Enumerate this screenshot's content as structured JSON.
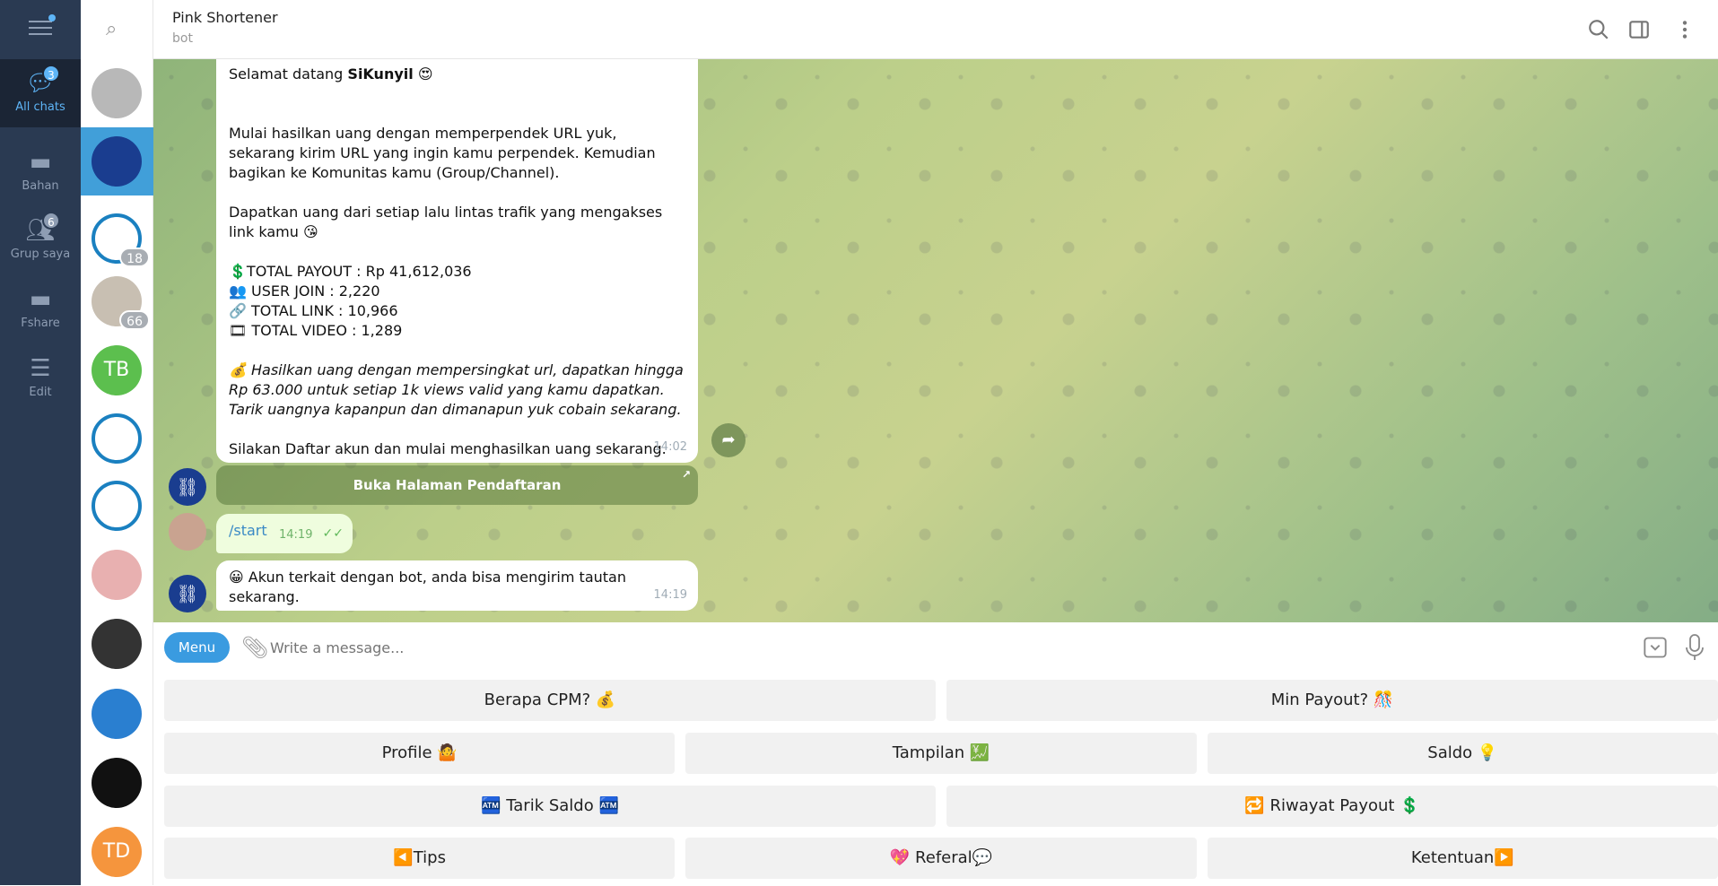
{
  "rail": {
    "items": [
      {
        "label": "All chats",
        "icon": "chat-bubbles-icon",
        "badge": "3",
        "active": true
      },
      {
        "label": "Bahan",
        "icon": "folder-icon"
      },
      {
        "label": "Grup saya",
        "icon": "users-icon",
        "badge": "6"
      },
      {
        "label": "Fshare",
        "icon": "folder-icon"
      },
      {
        "label": "Edit",
        "icon": "sliders-icon"
      }
    ]
  },
  "chat_list": [
    {
      "initials": "",
      "color": "#b8b8b8"
    },
    {
      "initials": "",
      "color": "#1a3d8f",
      "selected": true
    },
    {
      "initials": "",
      "color": "#ffffff",
      "count": "18"
    },
    {
      "initials": "",
      "color": "#c8bfb2",
      "count": "66"
    },
    {
      "initials": "TB",
      "color": "#5cbf4e"
    },
    {
      "initials": "",
      "color": "#ffffff"
    },
    {
      "initials": "",
      "color": "#ffffff"
    },
    {
      "initials": "",
      "color": "#e8b0b0"
    },
    {
      "initials": "",
      "color": "#333333"
    },
    {
      "initials": "",
      "color": "#2a7fd0"
    },
    {
      "initials": "",
      "color": "#111111"
    },
    {
      "initials": "TD",
      "color": "#f5953d"
    }
  ],
  "header": {
    "title": "Pink Shortener",
    "subtitle": "bot"
  },
  "messages": {
    "welcome_prefix": "Selamat datang ",
    "welcome_name": "SiKunyil",
    "welcome_emoji": "😍",
    "p1": "Mulai hasilkan uang dengan memperpendek URL yuk, sekarang kirim URL yang ingin kamu perpendek. Kemudian bagikan ke Komunitas kamu (Group/Channel).",
    "p2": "Dapatkan uang dari setiap lalu lintas trafik yang mengakses link kamu 😘",
    "stat1": "💲TOTAL PAYOUT : Rp 41,612,036",
    "stat2": "👥 USER JOIN : 2,220",
    "stat3": "🔗 TOTAL LINK : 10,966",
    "stat4": "🎞 TOTAL VIDEO : 1,289",
    "p3": "💰 Hasilkan uang dengan mempersingkat url, dapatkan hingga Rp 63.000 untuk setiap 1k views valid yang kamu dapatkan. Tarik uangnya kapanpun dan dimanapun yuk cobain sekarang.",
    "p4": "Silakan Daftar akun dan mulai menghasilkan uang sekarang.",
    "time1": "14:02",
    "inline_button": "Buka Halaman Pendaftaran",
    "start": "/start",
    "time2": "14:19",
    "linked": "😀 Akun terkait dengan bot, anda bisa mengirim tautan sekarang.",
    "time3": "14:19"
  },
  "input": {
    "menu": "Menu",
    "placeholder": "Write a message..."
  },
  "keyboard": [
    [
      "Berapa CPM? 💰",
      "Min Payout? 🎊"
    ],
    [
      "Profile 🤷",
      "Tampilan 💹",
      "Saldo 💡"
    ],
    [
      "🏧 Tarik Saldo 🏧",
      "🔁 Riwayat Payout 💲"
    ],
    [
      "◀️Tips",
      "💖 Referal💬",
      "Ketentuan▶️"
    ]
  ],
  "colors": {
    "accent": "#3a9be0",
    "rail": "#2a3a52",
    "selected": "#419fd9"
  }
}
